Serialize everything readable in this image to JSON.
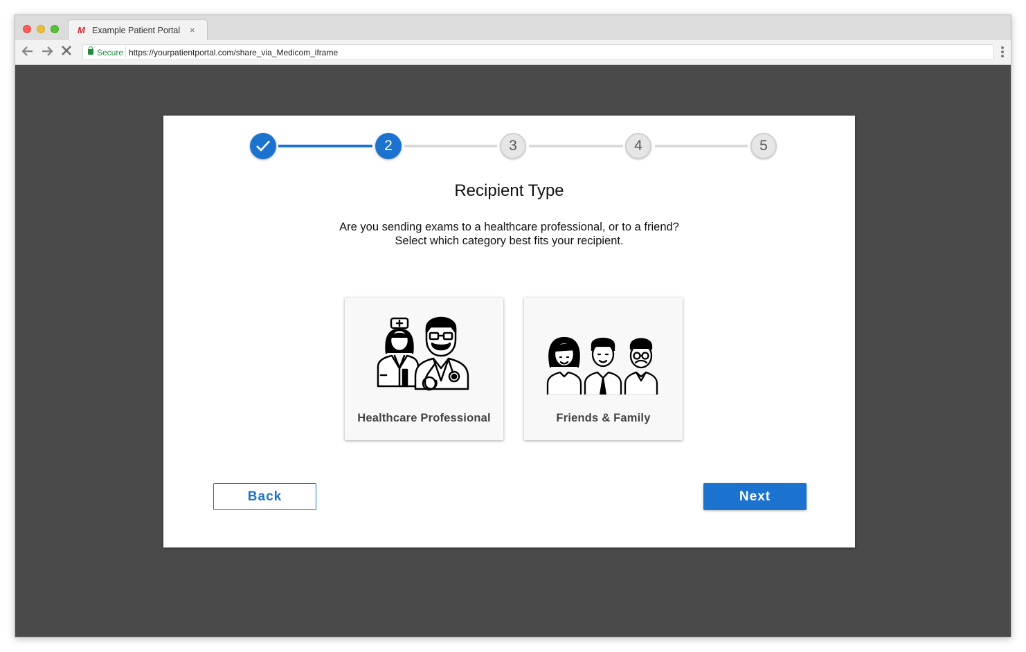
{
  "browser": {
    "tab_title": "Example Patient Portal",
    "tab_favicon": "M",
    "tab_close": "×",
    "secure_label": "Secure",
    "url": "https://yourpatientportal.com/share_via_Medicom_iframe",
    "nav_icons": [
      "back-arrow-icon",
      "forward-arrow-icon",
      "stop-loading-icon"
    ]
  },
  "stepper": {
    "current_step": 2,
    "steps": [
      {
        "label": "",
        "state": "completed",
        "icon": "checkmark-icon"
      },
      {
        "label": "2",
        "state": "active"
      },
      {
        "label": "3",
        "state": "pending"
      },
      {
        "label": "4",
        "state": "pending"
      },
      {
        "label": "5",
        "state": "pending"
      }
    ]
  },
  "page": {
    "title": "Recipient Type",
    "subtitle_line1": "Are you sending exams to a healthcare professional, or to a friend?",
    "subtitle_line2": "Select which category best fits your recipient."
  },
  "options": [
    {
      "label": "Healthcare Professional",
      "icon": "nurse-and-doctor-icon"
    },
    {
      "label": "Friends & Family",
      "icon": "family-group-icon"
    }
  ],
  "actions": {
    "back_label": "Back",
    "next_label": "Next"
  },
  "colors": {
    "accent": "#1b72cf",
    "backdrop": "#4a4a4a",
    "secure": "#1d8a3c"
  }
}
